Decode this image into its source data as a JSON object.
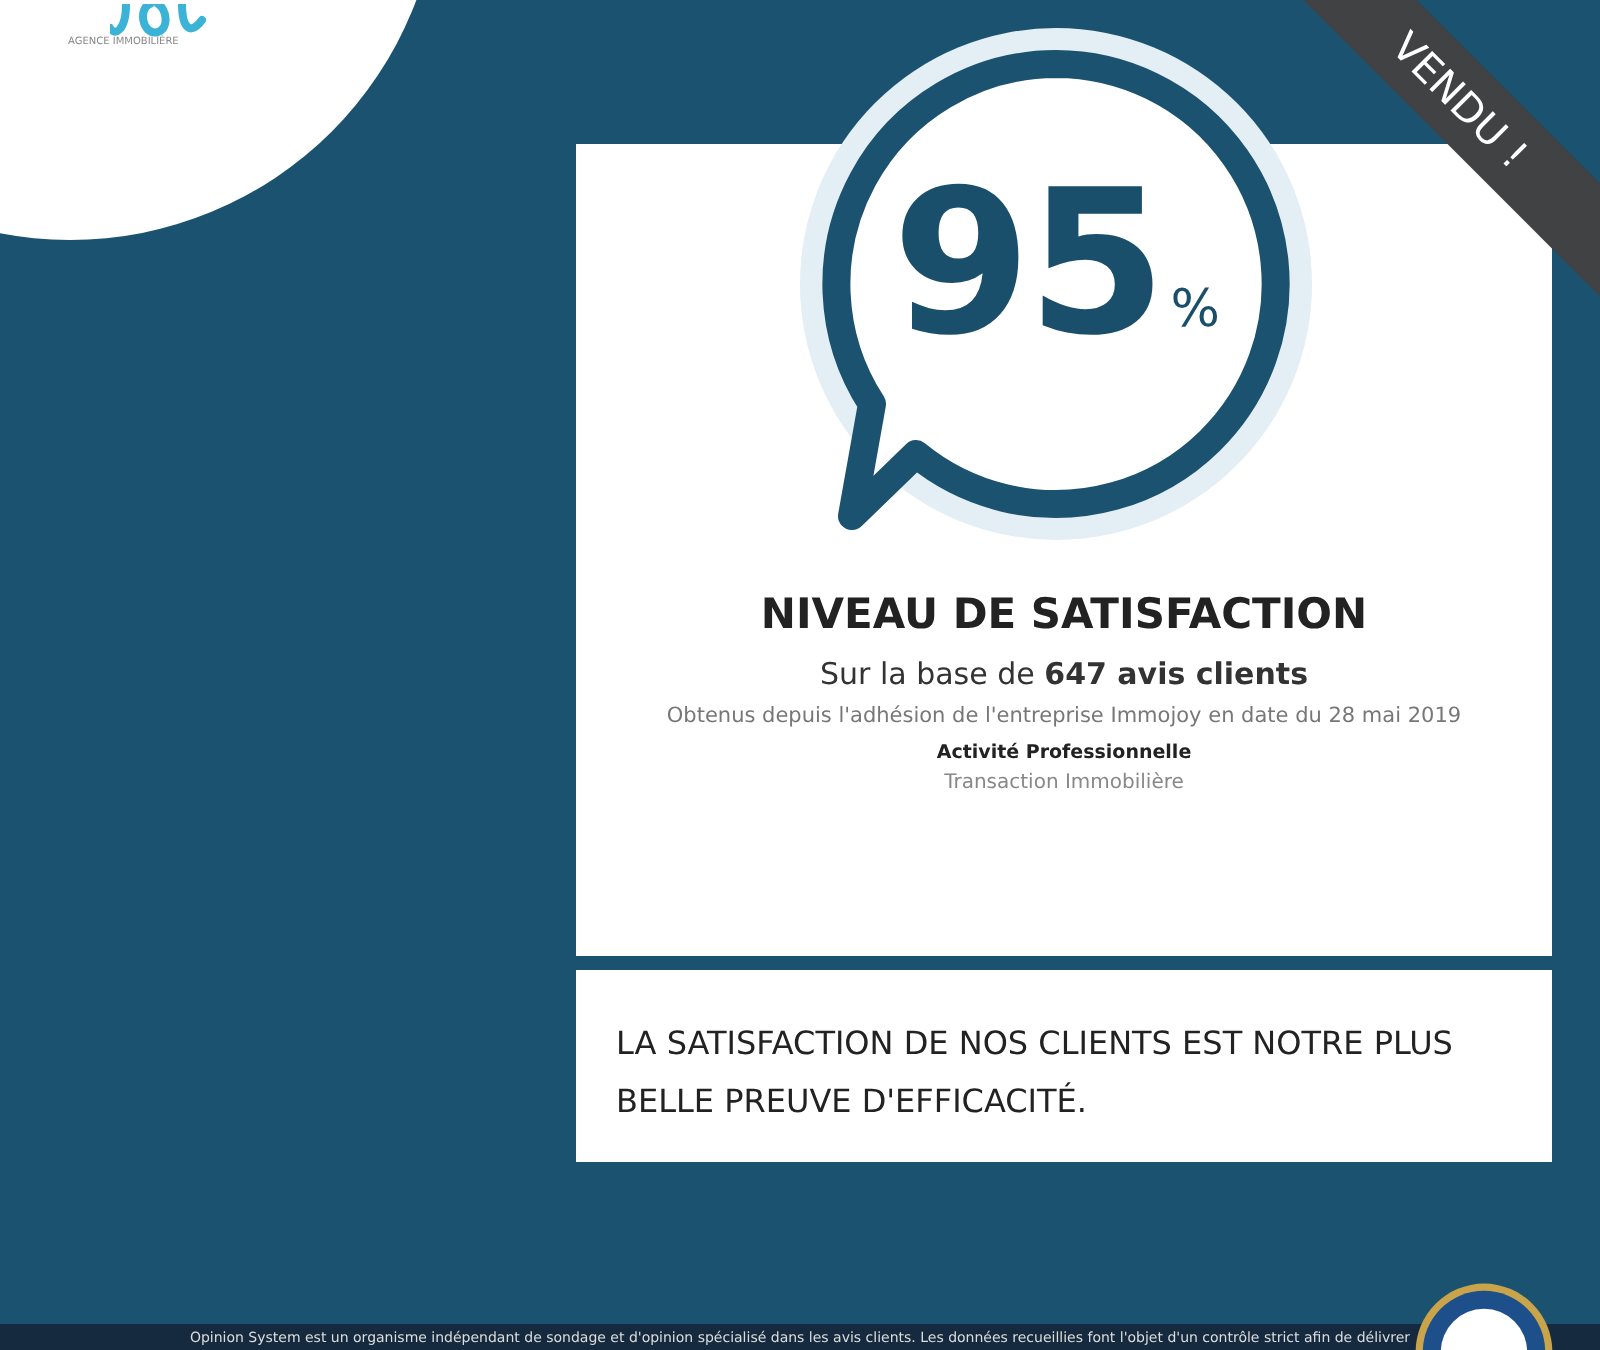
{
  "logo": {
    "tagline": "AGENCE IMMOBILIÈRE"
  },
  "ribbon": {
    "label": "VENDU !"
  },
  "score": {
    "value": "95",
    "unit": "%"
  },
  "card": {
    "title": "NIVEAU DE SATISFACTION",
    "basis": "Sur la base de **647 avis clients**",
    "since": "Obtenus depuis l'adhésion de l'entreprise Immojoy en date du 28 mai 2019",
    "activity_label": "Activité Professionnelle",
    "activity": "Transaction Immobilière"
  },
  "quote": "LA SATISFACTION DE NOS CLIENTS EST NOTRE PLUS BELLE PREUVE D'EFFICACITÉ.",
  "footer": {
    "text": "Opinion System est un organisme indépendant de sondage et d'opinion spécialisé dans les avis clients. Les données recueillies font l'objet d'un contrôle strict afin de délivrer"
  }
}
